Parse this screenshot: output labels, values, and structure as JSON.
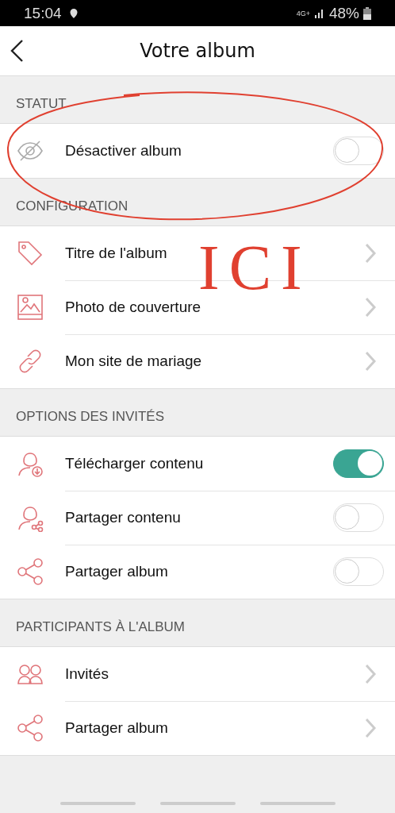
{
  "status_bar": {
    "time": "15:04",
    "network": "4G+",
    "battery": "48%"
  },
  "header": {
    "title": "Votre album"
  },
  "sections": [
    {
      "title": "STATUT",
      "rows": [
        {
          "label": "Désactiver album",
          "kind": "toggle",
          "on": false
        }
      ]
    },
    {
      "title": "CONFIGURATION",
      "rows": [
        {
          "label": "Titre de l'album",
          "kind": "link"
        },
        {
          "label": "Photo de couverture",
          "kind": "link"
        },
        {
          "label": "Mon site de mariage",
          "kind": "link"
        }
      ]
    },
    {
      "title": "OPTIONS DES INVITÉS",
      "rows": [
        {
          "label": "Télécharger contenu",
          "kind": "toggle",
          "on": true
        },
        {
          "label": "Partager contenu",
          "kind": "toggle",
          "on": false
        },
        {
          "label": "Partager album",
          "kind": "toggle",
          "on": false
        }
      ]
    },
    {
      "title": "PARTICIPANTS À L'ALBUM",
      "rows": [
        {
          "label": "Invités",
          "kind": "link"
        },
        {
          "label": "Partager album",
          "kind": "link"
        }
      ]
    }
  ],
  "annotation": {
    "text": "ICI"
  }
}
